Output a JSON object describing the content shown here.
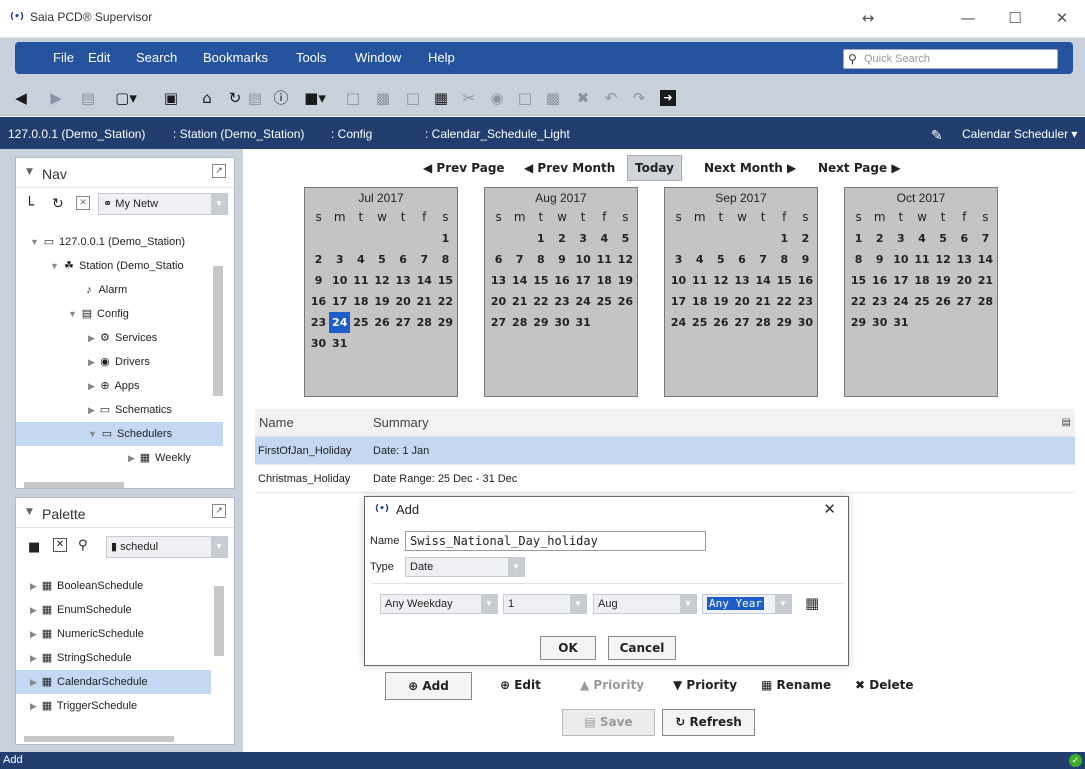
{
  "window": {
    "title": "Saia PCD® Supervisor",
    "logo": "(•)",
    "resize_glyph": "↔",
    "minimize_glyph": "—",
    "maximize_glyph": "☐",
    "close_glyph": "✕"
  },
  "menu": {
    "items": [
      "File",
      "Edit",
      "Search",
      "Bookmarks",
      "Tools",
      "Window",
      "Help"
    ],
    "quick_search_placeholder": "Quick Search"
  },
  "toolbar": {
    "icons": [
      "back-icon",
      "forward-icon",
      "up-level-icon",
      "folder-icon",
      "pane-icon",
      "home-icon",
      "refresh-icon",
      "history-icon",
      "info-icon",
      "open-icon",
      "save-icon",
      "save-all-icon",
      "export-icon",
      "import-icon",
      "cut-icon",
      "copy-icon",
      "paste-icon",
      "duplicate-icon",
      "delete-icon",
      "undo-icon",
      "redo-icon",
      "login-icon"
    ]
  },
  "breadcrumb": {
    "items": [
      "127.0.0.1 (Demo_Station)",
      ": Station (Demo_Station)",
      ": Config",
      ": Calendar_Schedule_Light"
    ],
    "view": "Calendar Scheduler",
    "view_arrow": "▾"
  },
  "nav": {
    "title": "Nav",
    "network_select": "My Netw",
    "tree": [
      {
        "label": "127.0.0.1 (Demo_Station)"
      },
      {
        "label": "Station (Demo_Statio"
      },
      {
        "label": "Alarm"
      },
      {
        "label": "Config"
      },
      {
        "label": "Services"
      },
      {
        "label": "Drivers"
      },
      {
        "label": "Apps"
      },
      {
        "label": "Schematics"
      },
      {
        "label": "Schedulers"
      },
      {
        "label": "Weekly"
      }
    ]
  },
  "palette": {
    "title": "Palette",
    "select": "schedul",
    "items": [
      "BooleanSchedule",
      "EnumSchedule",
      "NumericSchedule",
      "StringSchedule",
      "CalendarSchedule",
      "TriggerSchedule"
    ]
  },
  "calendar_nav": {
    "prev_page": "Prev Page",
    "prev_month": "Prev Month",
    "today": "Today",
    "next_month": "Next Month",
    "next_page": "Next Page"
  },
  "weekday_headers": [
    "s",
    "m",
    "t",
    "w",
    "t",
    "f",
    "s"
  ],
  "months": [
    {
      "title": "Jul 2017",
      "start": 6,
      "days": 31,
      "today": 24
    },
    {
      "title": "Aug 2017",
      "start": 2,
      "days": 31
    },
    {
      "title": "Sep 2017",
      "start": 5,
      "days": 30
    },
    {
      "title": "Oct 2017",
      "start": 0,
      "days": 31
    }
  ],
  "table": {
    "headers": [
      "Name",
      "Summary"
    ],
    "rows": [
      {
        "name": "FirstOfJan_Holiday",
        "summary": "Date: 1 Jan"
      },
      {
        "name": "Christmas_Holiday",
        "summary": "Date Range: 25 Dec - 31 Dec"
      }
    ]
  },
  "dialog": {
    "title": "Add",
    "name_label": "Name",
    "name_value": "Swiss_National_Day_holiday",
    "type_label": "Type",
    "type_value": "Date",
    "weekday": "Any Weekday",
    "day": "1",
    "month": "Aug",
    "year": "Any Year",
    "ok": "OK",
    "cancel": "Cancel"
  },
  "actions": {
    "add": "Add",
    "edit": "Edit",
    "priority_up": "Priority",
    "priority_down": "Priority",
    "rename": "Rename",
    "delete": "Delete",
    "save": "Save",
    "refresh": "Refresh"
  },
  "status": {
    "text": "Add"
  }
}
